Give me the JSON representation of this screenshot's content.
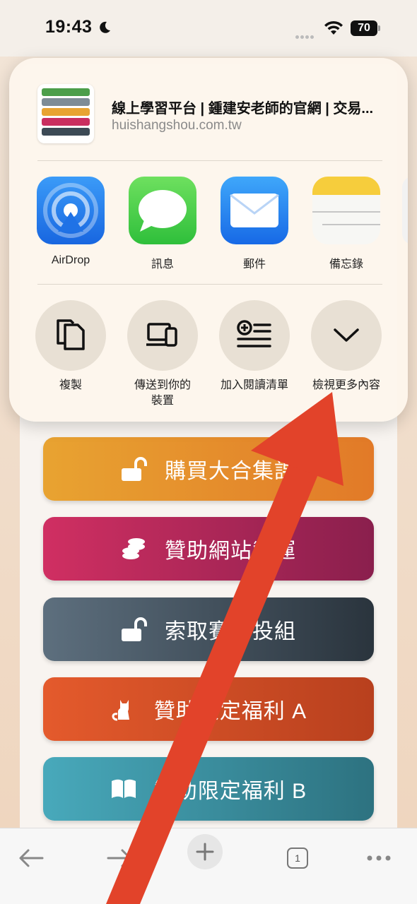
{
  "status_bar": {
    "time": "19:43",
    "battery": "70"
  },
  "page": {
    "buttons": [
      {
        "label": "購買大合集課",
        "color_start": "#e8a331",
        "color_end": "#e27a28"
      },
      {
        "label": "贊助網站營運",
        "color_start": "#d02f62",
        "color_end": "#8a1f4d"
      },
      {
        "label": "索取賽馬投組",
        "color_start": "#5d6f7e",
        "color_end": "#2a343d"
      },
      {
        "label": "贊助限定福利 A",
        "color_start": "#e45a2c",
        "color_end": "#b8401e"
      },
      {
        "label": "贊助限定福利 B",
        "color_start": "#48a9bb",
        "color_end": "#2d7280"
      }
    ]
  },
  "share_sheet": {
    "title": "線上學習平台 | 鍾建安老師的官網 | 交易...",
    "url": "huishangshou.com.tw",
    "apps": [
      {
        "label": "AirDrop",
        "icon": "airdrop-icon"
      },
      {
        "label": "訊息",
        "icon": "messages-icon"
      },
      {
        "label": "郵件",
        "icon": "mail-icon"
      },
      {
        "label": "備忘錄",
        "icon": "notes-icon"
      }
    ],
    "actions": [
      {
        "label": "複製",
        "icon": "copy-icon"
      },
      {
        "label": "傳送到你的\n裝置",
        "label_line1": "傳送到你的",
        "label_line2": "裝置",
        "icon": "send-to-devices-icon"
      },
      {
        "label": "加入閱讀清單",
        "icon": "add-reading-list-icon"
      },
      {
        "label": "檢視更多內容",
        "icon": "chevron-down-icon"
      }
    ]
  },
  "toolbar": {
    "tab_count": "1"
  },
  "annotation": {
    "arrow_color": "#e2432a"
  }
}
